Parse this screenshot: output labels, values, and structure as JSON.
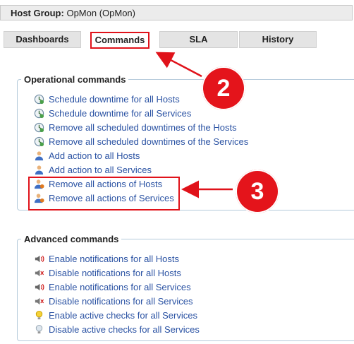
{
  "host_group": {
    "label": "Host Group:",
    "value": "OpMon (OpMon)"
  },
  "tabs": [
    {
      "label": "Dashboards"
    },
    {
      "label": "Commands"
    },
    {
      "label": "SLA"
    },
    {
      "label": "History"
    }
  ],
  "operational": {
    "title": "Operational commands",
    "items": [
      {
        "label": "Schedule downtime for all Hosts",
        "icon": "clock-icon"
      },
      {
        "label": "Schedule downtime for all Services",
        "icon": "clock-icon"
      },
      {
        "label": "Remove all scheduled downtimes of the Hosts",
        "icon": "clock-icon"
      },
      {
        "label": "Remove all scheduled downtimes of the Services",
        "icon": "clock-icon"
      },
      {
        "label": "Add action to all Hosts",
        "icon": "user-icon"
      },
      {
        "label": "Add action to all Services",
        "icon": "user-icon"
      },
      {
        "label": "Remove all actions of Hosts",
        "icon": "user-remove-icon"
      },
      {
        "label": "Remove all actions of Services",
        "icon": "user-remove-icon"
      }
    ]
  },
  "advanced": {
    "title": "Advanced commands",
    "items": [
      {
        "label": "Enable notifications for all Hosts",
        "icon": "speaker-on-icon"
      },
      {
        "label": "Disable notifications for all Hosts",
        "icon": "speaker-off-icon"
      },
      {
        "label": "Enable notifications for all Services",
        "icon": "speaker-on-icon"
      },
      {
        "label": "Disable notifications for all Services",
        "icon": "speaker-off-icon"
      },
      {
        "label": "Enable active checks for all Services",
        "icon": "bulb-on-icon"
      },
      {
        "label": "Disable active checks for all Services",
        "icon": "bulb-off-icon"
      }
    ]
  },
  "annotations": {
    "badge2": "2",
    "badge3": "3"
  },
  "colors": {
    "accent_red": "#e0121a",
    "link_blue": "#2a52a3"
  }
}
